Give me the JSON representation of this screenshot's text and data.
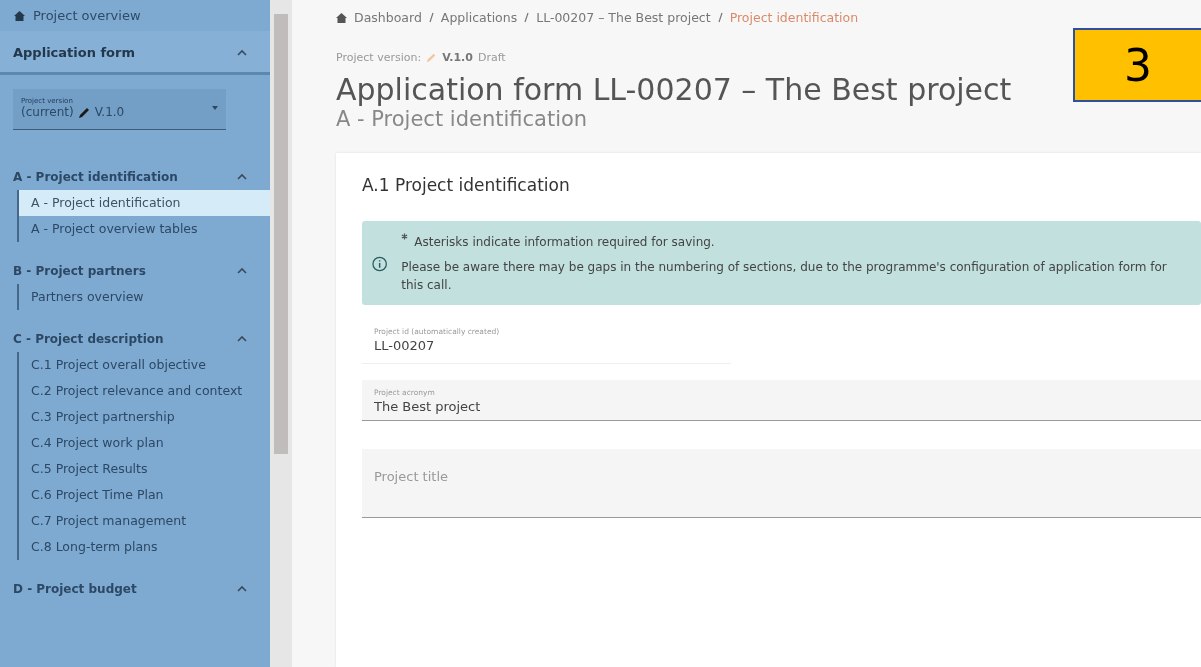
{
  "sidebar": {
    "overview": "Project overview",
    "form_header": {
      "title": "Application form",
      "expanded": true
    },
    "version": {
      "label": "Project version",
      "value_prefix": "(current)",
      "value": "V.1.0"
    },
    "sections": [
      {
        "title": "A - Project identification",
        "expanded": true,
        "children": [
          {
            "label": "A - Project identification",
            "selected": true
          },
          {
            "label": "A - Project overview tables",
            "selected": false
          }
        ]
      },
      {
        "title": "B - Project partners",
        "expanded": true,
        "children": [
          {
            "label": "Partners overview",
            "selected": false
          }
        ]
      },
      {
        "title": "C - Project description",
        "expanded": true,
        "children": [
          {
            "label": "C.1 Project overall objective",
            "selected": false
          },
          {
            "label": "C.2 Project relevance and context",
            "selected": false
          },
          {
            "label": "C.3 Project partnership",
            "selected": false
          },
          {
            "label": "C.4 Project work plan",
            "selected": false
          },
          {
            "label": "C.5 Project Results",
            "selected": false
          },
          {
            "label": "C.6 Project Time Plan",
            "selected": false
          },
          {
            "label": "C.7 Project management",
            "selected": false
          },
          {
            "label": "C.8 Long-term plans",
            "selected": false
          }
        ]
      },
      {
        "title": "D - Project budget",
        "expanded": true
      }
    ]
  },
  "breadcrumb": [
    "Dashboard",
    "Applications",
    "LL-00207 – The Best project",
    "Project identification"
  ],
  "version_line": {
    "label": "Project version:",
    "version": "V.1.0",
    "status": "Draft"
  },
  "title": "Application form LL-00207 – The Best project",
  "subtitle": "A - Project identification",
  "callout": "3",
  "card": {
    "title": "A.1 Project identification",
    "info": {
      "required_note": "Asterisks indicate information required for saving.",
      "text": "Please be aware there may be gaps in the numbering of sections, due to the programme's configuration of application form for this call."
    },
    "fields": [
      {
        "kind": "readonly",
        "label": "Project id (automatically created)",
        "value": "LL-00207"
      },
      {
        "kind": "input",
        "label": "Project acronym",
        "value": "The Best project"
      },
      {
        "kind": "textarea",
        "placeholder": "Project title"
      }
    ]
  }
}
